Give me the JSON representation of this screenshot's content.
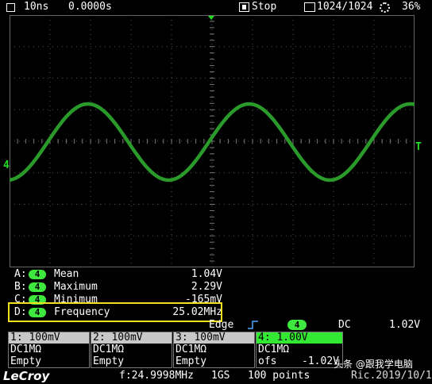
{
  "topbar": {
    "timebase": "10ns",
    "delay": "0.0000s",
    "stop": "Stop",
    "acq": "1024/1024",
    "pct": "36%"
  },
  "screen": {
    "channel_marker": "4",
    "trigger_marker": "T"
  },
  "measurements": [
    {
      "slot": "A:",
      "ch": "4",
      "name": "Mean",
      "value": "1.04V"
    },
    {
      "slot": "B:",
      "ch": "4",
      "name": "Maximum",
      "value": "2.29V"
    },
    {
      "slot": "C:",
      "ch": "4",
      "name": "Minimum",
      "value": "-165mV"
    },
    {
      "slot": "D:",
      "ch": "4",
      "name": "Frequency",
      "value": "25.02MHz"
    }
  ],
  "trigger": {
    "type": "Edge",
    "ch": "4",
    "coupling": "DC",
    "level": "1.02V"
  },
  "channels": [
    {
      "header": "1: 100mV",
      "coupling": "DC1MΩ",
      "status": "Empty"
    },
    {
      "header": "2: 100mV",
      "coupling": "DC1MΩ",
      "status": "Empty"
    },
    {
      "header": "3: 100mV",
      "coupling": "DC1MΩ",
      "status": "Empty"
    },
    {
      "header": "4: 1.00V",
      "coupling": "DC1MΩ",
      "status": "ofs",
      "offset": "-1.02V"
    }
  ],
  "bottom": {
    "brand": "LeCroy",
    "freq": "f:24.9998MHz",
    "rate": "1GS",
    "points": "100 points",
    "date": "Ric.2019/10/1",
    "watermark": "头条 @跟我学电脑"
  },
  "colors": {
    "trace": "#2a9a2a",
    "highlight": "#f0e020",
    "pill": "#3ee83e"
  }
}
